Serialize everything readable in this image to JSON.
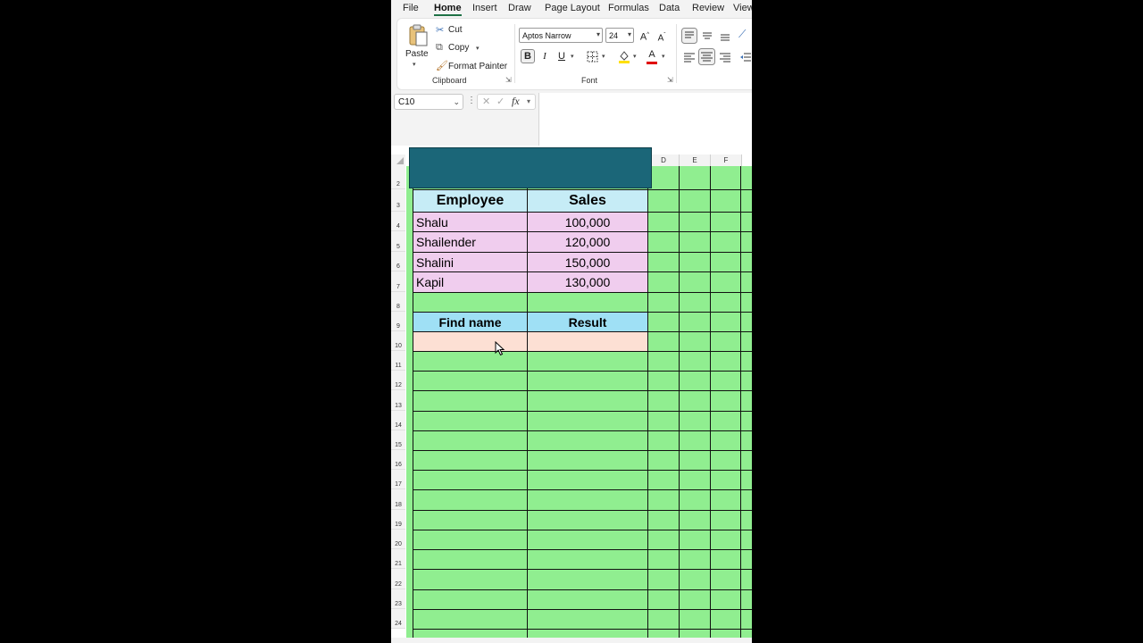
{
  "tabs": [
    "File",
    "Home",
    "Insert",
    "Draw",
    "Page Layout",
    "Formulas",
    "Data",
    "Review",
    "View"
  ],
  "active_tab": "Home",
  "clipboard": {
    "paste_label": "Paste",
    "cut_label": "Cut",
    "copy_label": "Copy",
    "format_painter_label": "Format Painter",
    "group_label": "Clipboard"
  },
  "font": {
    "font_name": "Aptos Narrow",
    "font_size": "24",
    "bold_label": "B",
    "italic_label": "I",
    "underline_label": "U",
    "grow_label": "A",
    "shrink_label": "A",
    "font_color_label": "A",
    "group_label": "Font"
  },
  "formula_bar": {
    "name_box": "C10",
    "fx_label": "fx",
    "formula": ""
  },
  "columns": [
    "D",
    "E",
    "F"
  ],
  "rows": [
    "2",
    "3",
    "4",
    "5",
    "6",
    "7",
    "8",
    "9",
    "10",
    "11",
    "12",
    "13",
    "14",
    "15",
    "16",
    "17",
    "18",
    "19",
    "20",
    "21",
    "22",
    "23",
    "24"
  ],
  "table": {
    "headers": [
      "Employee",
      "Sales"
    ],
    "rows": [
      {
        "employee": "Shalu",
        "sales": "100,000"
      },
      {
        "employee": "Shailender",
        "sales": "120,000"
      },
      {
        "employee": "Shalini",
        "sales": "150,000"
      },
      {
        "employee": "Kapil",
        "sales": "130,000"
      }
    ]
  },
  "lookup": {
    "headers": [
      "Find name",
      "Result"
    ]
  },
  "colors": {
    "grid_fill": "#90ee90",
    "banner_fill": "#1b6678",
    "header_fill": "#c6ecf6",
    "data_fill": "#f0cdee",
    "input_fill": "#fde0d4",
    "accent": "#1e7145"
  }
}
